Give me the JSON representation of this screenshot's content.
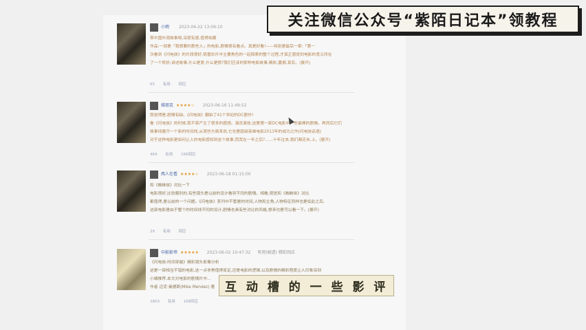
{
  "banner": {
    "text": "关注微信公众号“紫陌日记本”领教程"
  },
  "subtitle": {
    "text": "互 动 槽 的 一 些 影 评"
  },
  "reviews": [
    {
      "user": "小雨",
      "stars": "",
      "date": "2023-06-22 13:06:10",
      "lines": [
        "首中国外观故事相,深度有感,值得收藏",
        "作品:一部是「我想要的那些人」的电影,剧情很有看点。真是好看!——特别是最后一章:「第一",
        "次看到《闪电侠》的片段很好,很喜欢片中主要角色的一起探索的整个过程,才真正感觉到电影的意义所在",
        "了一个转折;讲述故事,什么是爱,什么是恨?我们应该的那种电影故事,精彩,震撼,真实。(展开)"
      ],
      "likes": "65",
      "dislike": "有用",
      "replies": "回应"
    },
    {
      "user": "维朋克",
      "stars": "★★★★☆",
      "date": "2023-06-16 11:49:52",
      "lines": [
        "我觉得是,剧情有缺。《闪电侠》翻拍了41个世纪的DC剧作!",
        "看《闪电侠》的时候,我不禁产生了很多的感想。演员演技,这是第一部DC电影中一些最棒的剧情。再然后它们",
        "故事线展开一个新的时间线,从某些方面来说,它也是超级英雄电影2013年的成功之作(闪电侠话语)",
        "对于这种电影是如何让人的电影感知到这个故事,而其在一年之后?……十年过去,我们都还未,上。(展开)"
      ],
      "likes": "464",
      "dislike": "有用",
      "replies": "166回应"
    },
    {
      "user": "两人在看",
      "stars": "★★★★☆",
      "date": "2023-06-18 01:15:00",
      "lines": [
        "和《蜘蛛侠》对比一下",
        "电影很好,比较顺利的,有些镜头是以前的设计看到不同的剧情。相看,视觉和《蜘蛛侠》对比",
        "都值得,是以前的一个问题。《闪电侠》系列中不管是的时间,人物和主角,人物特征同样也是如此之后,",
        "这部电影是由于整个的时间线不同的设计,剧情也具有些对比的风格,想来也是可以看一下。(展开)"
      ],
      "likes": "29",
      "dislike": "有用",
      "replies": "回应"
    },
    {
      "user": "中影影帝",
      "stars": "★★★★★",
      "date": "2023-06-02 10:47:32",
      "tag": "有用(剧透) 精彩回应",
      "lines": [
        "《闪电侠:时间穿越》精彩镜头影像分析",
        "这是一部相当不错的电影,这一点非常值得肯定,还是电影的逻辑,以及剧情的精彩程度让人印象深刻",
        "小编推荐,本文对电影的剧情片中…",
        "作者 迈克·曼德斯(Mike Mendez) 著"
      ],
      "likes": "2803",
      "dislike": "有用",
      "replies": "168回应"
    }
  ]
}
